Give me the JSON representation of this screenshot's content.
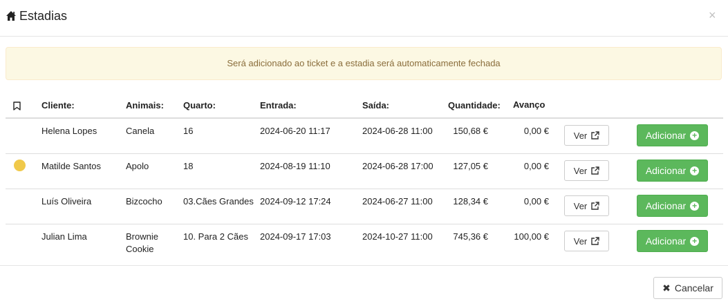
{
  "modal": {
    "title": "Estadias",
    "close_label": "×",
    "alert": "Será adicionado ao ticket e a estadia será automaticamente fechada"
  },
  "table": {
    "headers": {
      "cliente": "Cliente:",
      "animais": "Animais:",
      "quarto": "Quarto:",
      "entrada": "Entrada:",
      "saida": "Saída:",
      "quantidade": "Quantidade:",
      "avanco": "Avanço"
    },
    "rows": [
      {
        "cliente": "Helena Lopes",
        "animais": "Canela",
        "quarto": "16",
        "entrada": "2024-06-20 11:17",
        "saida": "2024-06-28 11:00",
        "quantidade": "150,68 €",
        "avanco": "0,00 €",
        "ver": "Ver",
        "adicionar": "Adicionar"
      },
      {
        "cliente": "Matilde Santos",
        "animais": "Apolo",
        "quarto": "18",
        "entrada": "2024-08-19 11:10",
        "saida": "2024-06-28 17:00",
        "quantidade": "127,05 €",
        "avanco": "0,00 €",
        "ver": "Ver",
        "adicionar": "Adicionar"
      },
      {
        "cliente": "Luís Oliveira",
        "animais": "Bizcocho",
        "quarto": "03.Cães Grandes",
        "entrada": "2024-09-12 17:24",
        "saida": "2024-06-27 11:00",
        "quantidade": "128,34 €",
        "avanco": "0,00 €",
        "ver": "Ver",
        "adicionar": "Adicionar"
      },
      {
        "cliente": "Julian Lima",
        "animais": "Brownie Cookie",
        "quarto": "10. Para 2 Cães",
        "entrada": "2024-09-17 17:03",
        "saida": "2024-10-27 11:00",
        "quantidade": "745,36 €",
        "avanco": "100,00 €",
        "ver": "Ver",
        "adicionar": "Adicionar"
      }
    ]
  },
  "footer": {
    "cancel_label": "Cancelar"
  },
  "colors": {
    "accent_green": "#5cb85c",
    "alert_bg": "#fcf8e3",
    "alert_text": "#8a6d3b",
    "status_dot": "#f0c94a"
  },
  "icons": {
    "header": "home-icon",
    "bookmark": "bookmark-icon",
    "ver": "external-link-icon",
    "add": "plus-circle-icon",
    "cancel": "times-icon"
  }
}
